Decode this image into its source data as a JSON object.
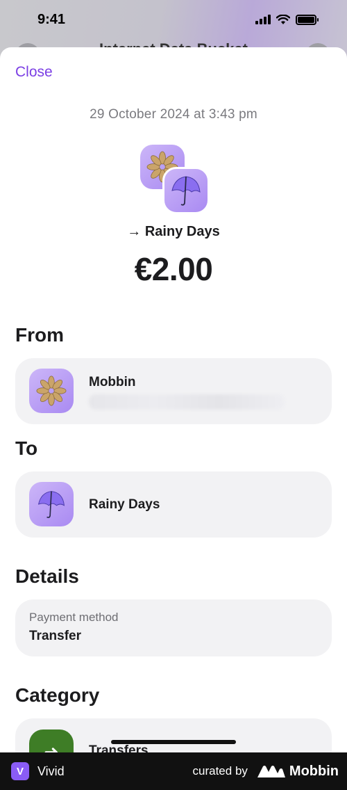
{
  "status_bar": {
    "time": "9:41"
  },
  "behind_sheet": {
    "title": "Internet Data Bucket"
  },
  "sheet": {
    "close_label": "Close",
    "date": "29 October 2024 at 3:43 pm",
    "destination": "→ Rainy Days",
    "amount": "€2.00"
  },
  "from": {
    "heading": "From",
    "name": "Mobbin",
    "icon": "flower-icon"
  },
  "to": {
    "heading": "To",
    "name": "Rainy Days",
    "icon": "umbrella-icon"
  },
  "details": {
    "heading": "Details",
    "label": "Payment method",
    "value": "Transfer"
  },
  "category": {
    "heading": "Category",
    "name": "Transfers",
    "icon": "arrow-right-icon",
    "icon_glyph": "➜",
    "color": "#3e7d26"
  },
  "footer": {
    "app_letter": "V",
    "app_name": "Vivid",
    "curated_by": "curated by",
    "brand": "Mobbin"
  },
  "colors": {
    "accent": "#7b3fe4",
    "card": "#f2f2f4",
    "footer": "#111111"
  }
}
